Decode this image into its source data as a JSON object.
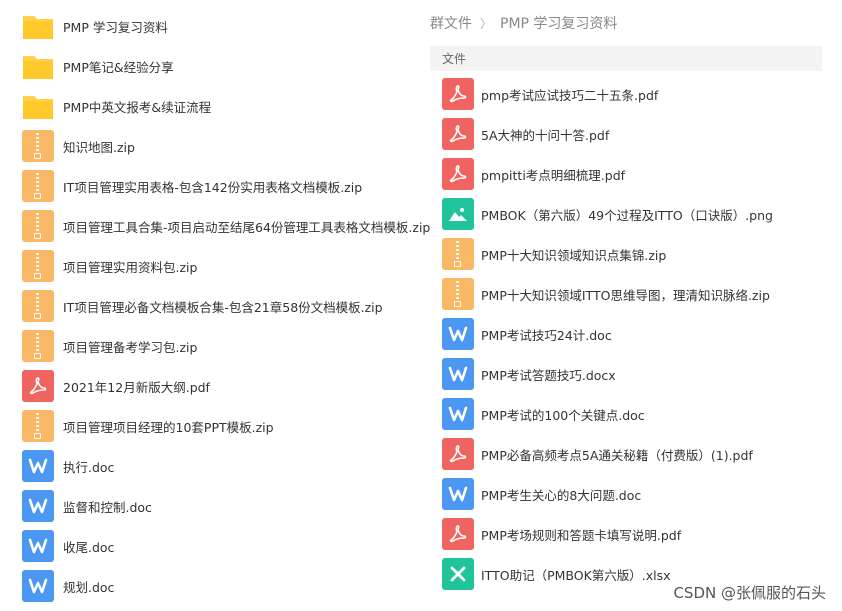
{
  "left_list": [
    {
      "name": "PMP 学习复习资料",
      "type": "folder"
    },
    {
      "name": "PMP笔记&经验分享",
      "type": "folder"
    },
    {
      "name": "PMP中英文报考&续证流程",
      "type": "folder"
    },
    {
      "name": "知识地图.zip",
      "type": "zip"
    },
    {
      "name": "IT项目管理实用表格-包含142份实用表格文档模板.zip",
      "type": "zip"
    },
    {
      "name": "项目管理工具合集-项目启动至结尾64份管理工具表格文档模板.zip",
      "type": "zip"
    },
    {
      "name": "项目管理实用资料包.zip",
      "type": "zip"
    },
    {
      "name": "IT项目管理必备文档模板合集-包含21章58份文档模板.zip",
      "type": "zip"
    },
    {
      "name": "项目管理备考学习包.zip",
      "type": "zip"
    },
    {
      "name": "2021年12月新版大纲.pdf",
      "type": "pdf"
    },
    {
      "name": "项目管理项目经理的10套PPT模板.zip",
      "type": "zip"
    },
    {
      "name": "执行.doc",
      "type": "doc"
    },
    {
      "name": "监督和控制.doc",
      "type": "doc"
    },
    {
      "name": "收尾.doc",
      "type": "doc"
    },
    {
      "name": "规划.doc",
      "type": "doc"
    }
  ],
  "breadcrumb": {
    "root": "群文件",
    "separator": "〉",
    "current": "PMP 学习复习资料"
  },
  "section_header": "文件",
  "right_list": [
    {
      "name": "pmp考试应试技巧二十五条.pdf",
      "type": "pdf"
    },
    {
      "name": "5A大神的十问十答.pdf",
      "type": "pdf"
    },
    {
      "name": "pmpitti考点明细梳理.pdf",
      "type": "pdf"
    },
    {
      "name": "PMBOK（第六版）49个过程及ITTO（口诀版）.png",
      "type": "png"
    },
    {
      "name": "PMP十大知识领域知识点集锦.zip",
      "type": "zip"
    },
    {
      "name": "PMP十大知识领域ITTO思维导图，理清知识脉络.zip",
      "type": "zip"
    },
    {
      "name": "PMP考试技巧24计.doc",
      "type": "doc"
    },
    {
      "name": "PMP考试答题技巧.docx",
      "type": "doc"
    },
    {
      "name": "PMP考试的100个关键点.doc",
      "type": "doc"
    },
    {
      "name": "PMP必备高频考点5A通关秘籍（付费版）(1).pdf",
      "type": "pdf"
    },
    {
      "name": "PMP考生关心的8大问题.doc",
      "type": "doc"
    },
    {
      "name": "PMP考场规则和答题卡填写说明.pdf",
      "type": "pdf"
    },
    {
      "name": "ITTO助记（PMBOK第六版）.xlsx",
      "type": "xlsx"
    }
  ],
  "watermark": "CSDN @张佩服的石头",
  "colors": {
    "folder": "#ffd04d",
    "zip": "#f9b865",
    "pdf": "#ef6460",
    "doc": "#4b97f2",
    "png": "#1fc49a",
    "xlsx": "#1fc49a"
  }
}
